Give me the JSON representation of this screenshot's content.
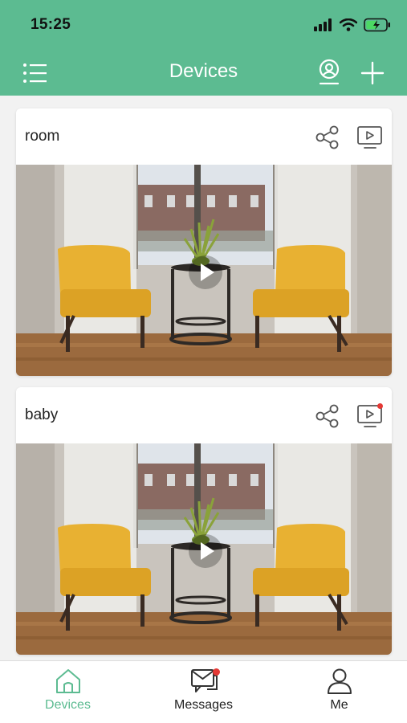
{
  "status_bar": {
    "time": "15:25"
  },
  "header": {
    "title": "Devices"
  },
  "devices": [
    {
      "name": "room",
      "has_new_playback": false
    },
    {
      "name": "baby",
      "has_new_playback": true
    }
  ],
  "tabs": [
    {
      "label": "Devices",
      "icon": "home-icon",
      "active": true
    },
    {
      "label": "Messages",
      "icon": "messages-icon",
      "active": false,
      "badge": true
    },
    {
      "label": "Me",
      "icon": "person-icon",
      "active": false
    }
  ],
  "colors": {
    "accent": "#5cbb91",
    "badge": "#e53935"
  }
}
